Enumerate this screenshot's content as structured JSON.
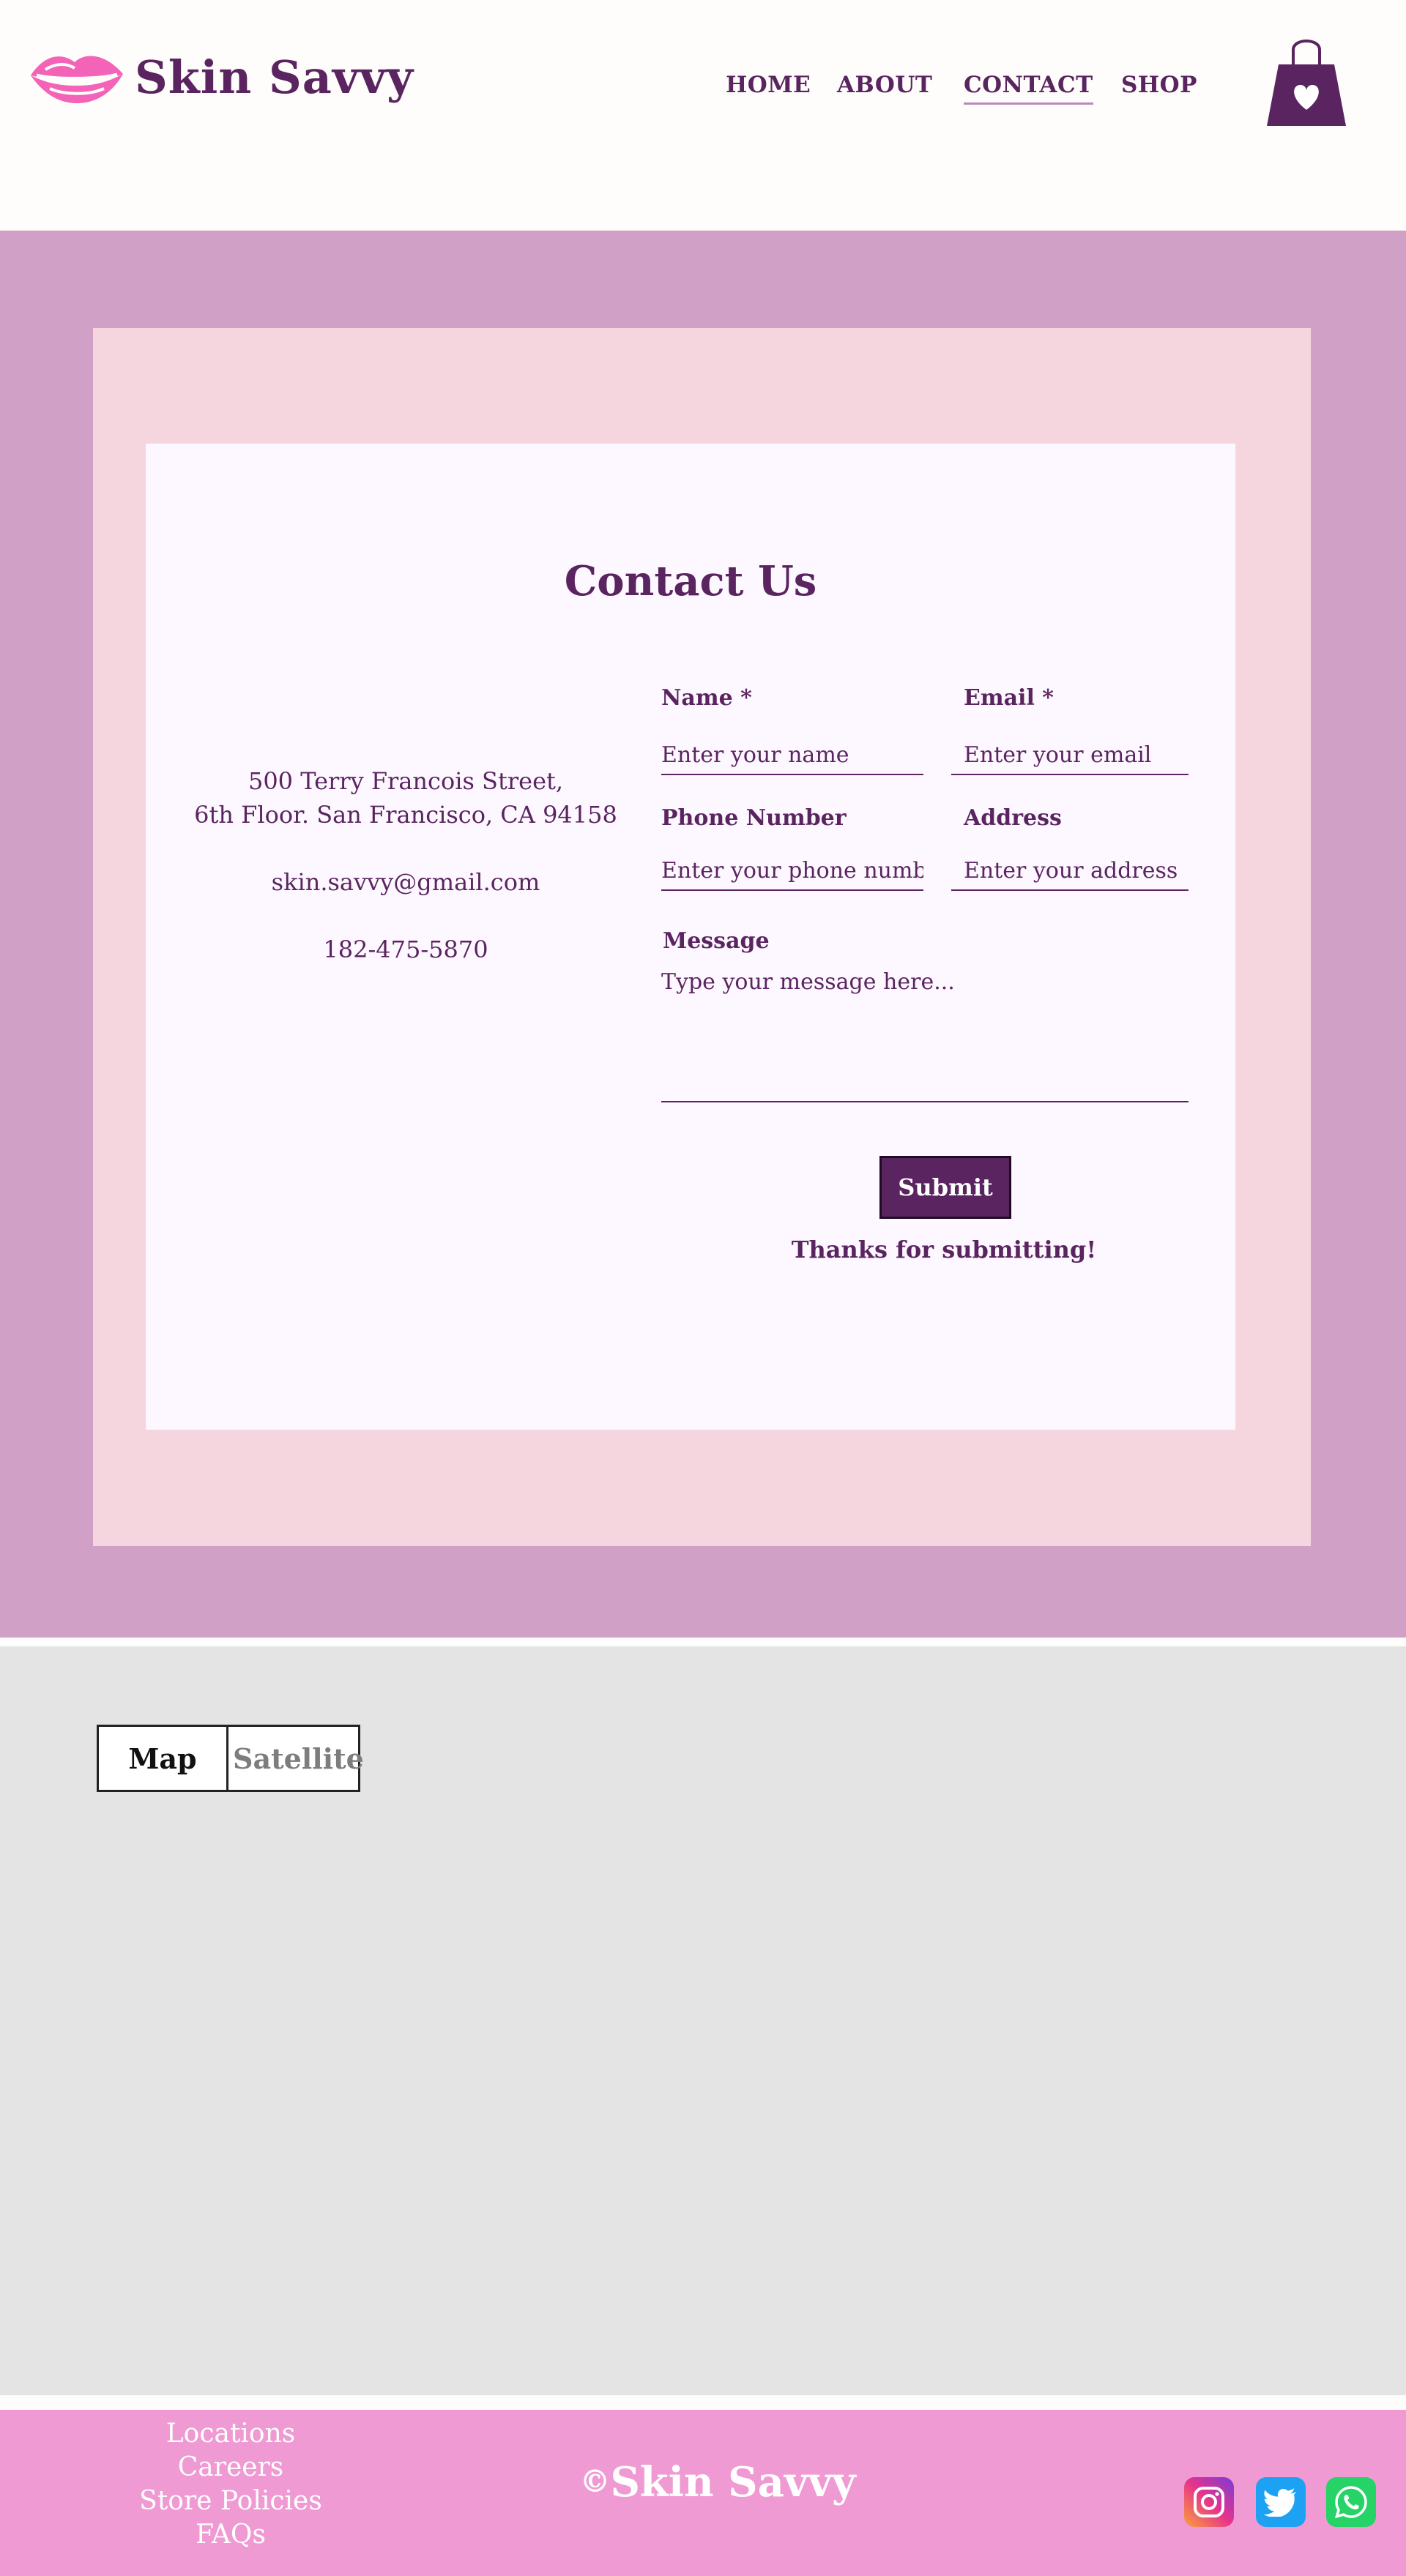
{
  "brand": {
    "name": "Skin Savvy",
    "logo_icon": "lips-icon",
    "primary_color": "#5a2460",
    "accent_pink": "#f363b7"
  },
  "nav": {
    "items": [
      {
        "label": "HOME",
        "active": false
      },
      {
        "label": "ABOUT",
        "active": false
      },
      {
        "label": "CONTACT",
        "active": true
      },
      {
        "label": "SHOP",
        "active": false
      }
    ],
    "cart_icon": "shopping-bag-heart-icon"
  },
  "contact": {
    "title": "Contact Us",
    "address_line1": "500 Terry Francois Street,",
    "address_line2": "6th Floor. San Francisco, CA 94158",
    "email": "skin.savvy@gmail.com",
    "phone": "182-475-5870",
    "form": {
      "name_label": "Name *",
      "name_placeholder": "Enter your name",
      "email_label": "Email *",
      "email_placeholder": "Enter your email",
      "phone_label": "Phone Number",
      "phone_placeholder": "Enter your phone number",
      "address_label": "Address",
      "address_placeholder": "Enter your address",
      "message_label": "Message",
      "message_placeholder": "Type your message here...",
      "submit_label": "Submit",
      "thanks_text": "Thanks for submitting!"
    }
  },
  "map": {
    "map_label": "Map",
    "satellite_label": "Satellite",
    "selected": "Map"
  },
  "footer": {
    "links": [
      "Locations",
      "Careers",
      "Store Policies",
      "FAQs"
    ],
    "copyright_symbol": "©",
    "copyright_name": "Skin Savvy",
    "social_icons": [
      "instagram-icon",
      "twitter-icon",
      "whatsapp-icon"
    ]
  },
  "colors": {
    "header_bg": "#fefdfb",
    "contact_band": "#d0a0c7",
    "contact_outer": "#f5d5de",
    "contact_card": "#fdf8ff",
    "map_bg": "#e4e4e4",
    "footer_bg": "#f09ad4"
  }
}
